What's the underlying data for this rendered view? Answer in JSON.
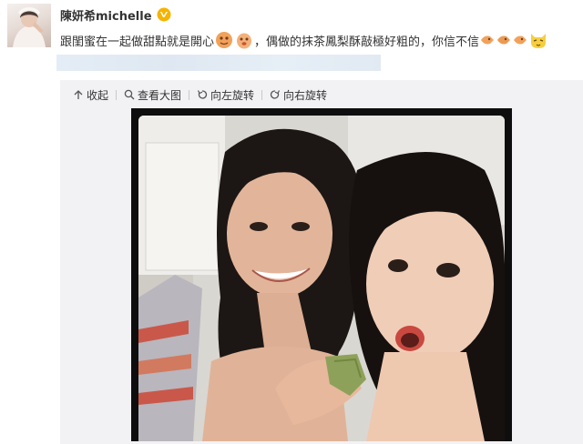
{
  "user": {
    "name": "陳妍希michelle"
  },
  "post": {
    "text_part1": "跟閨蜜在一起做甜點就是開心",
    "text_part2": "，偶做的抹茶鳳梨酥敲極好粗的，你信不信"
  },
  "toolbar": {
    "collapse": "收起",
    "view_large": "查看大图",
    "rotate_left": "向左旋转",
    "rotate_right": "向右旋转"
  },
  "colors": {
    "vip_badge": "#f5b400",
    "emoji_orange": "#f0a25b",
    "cat_yellow": "#f6cf3f",
    "media_bg": "#f2f2f5",
    "photo_frame": "#0e0e0e"
  },
  "icons": [
    "vip-badge-icon",
    "emoji-icon",
    "cat-emoji-icon",
    "collapse-icon",
    "magnifier-icon",
    "rotate-left-icon",
    "rotate-right-icon"
  ]
}
